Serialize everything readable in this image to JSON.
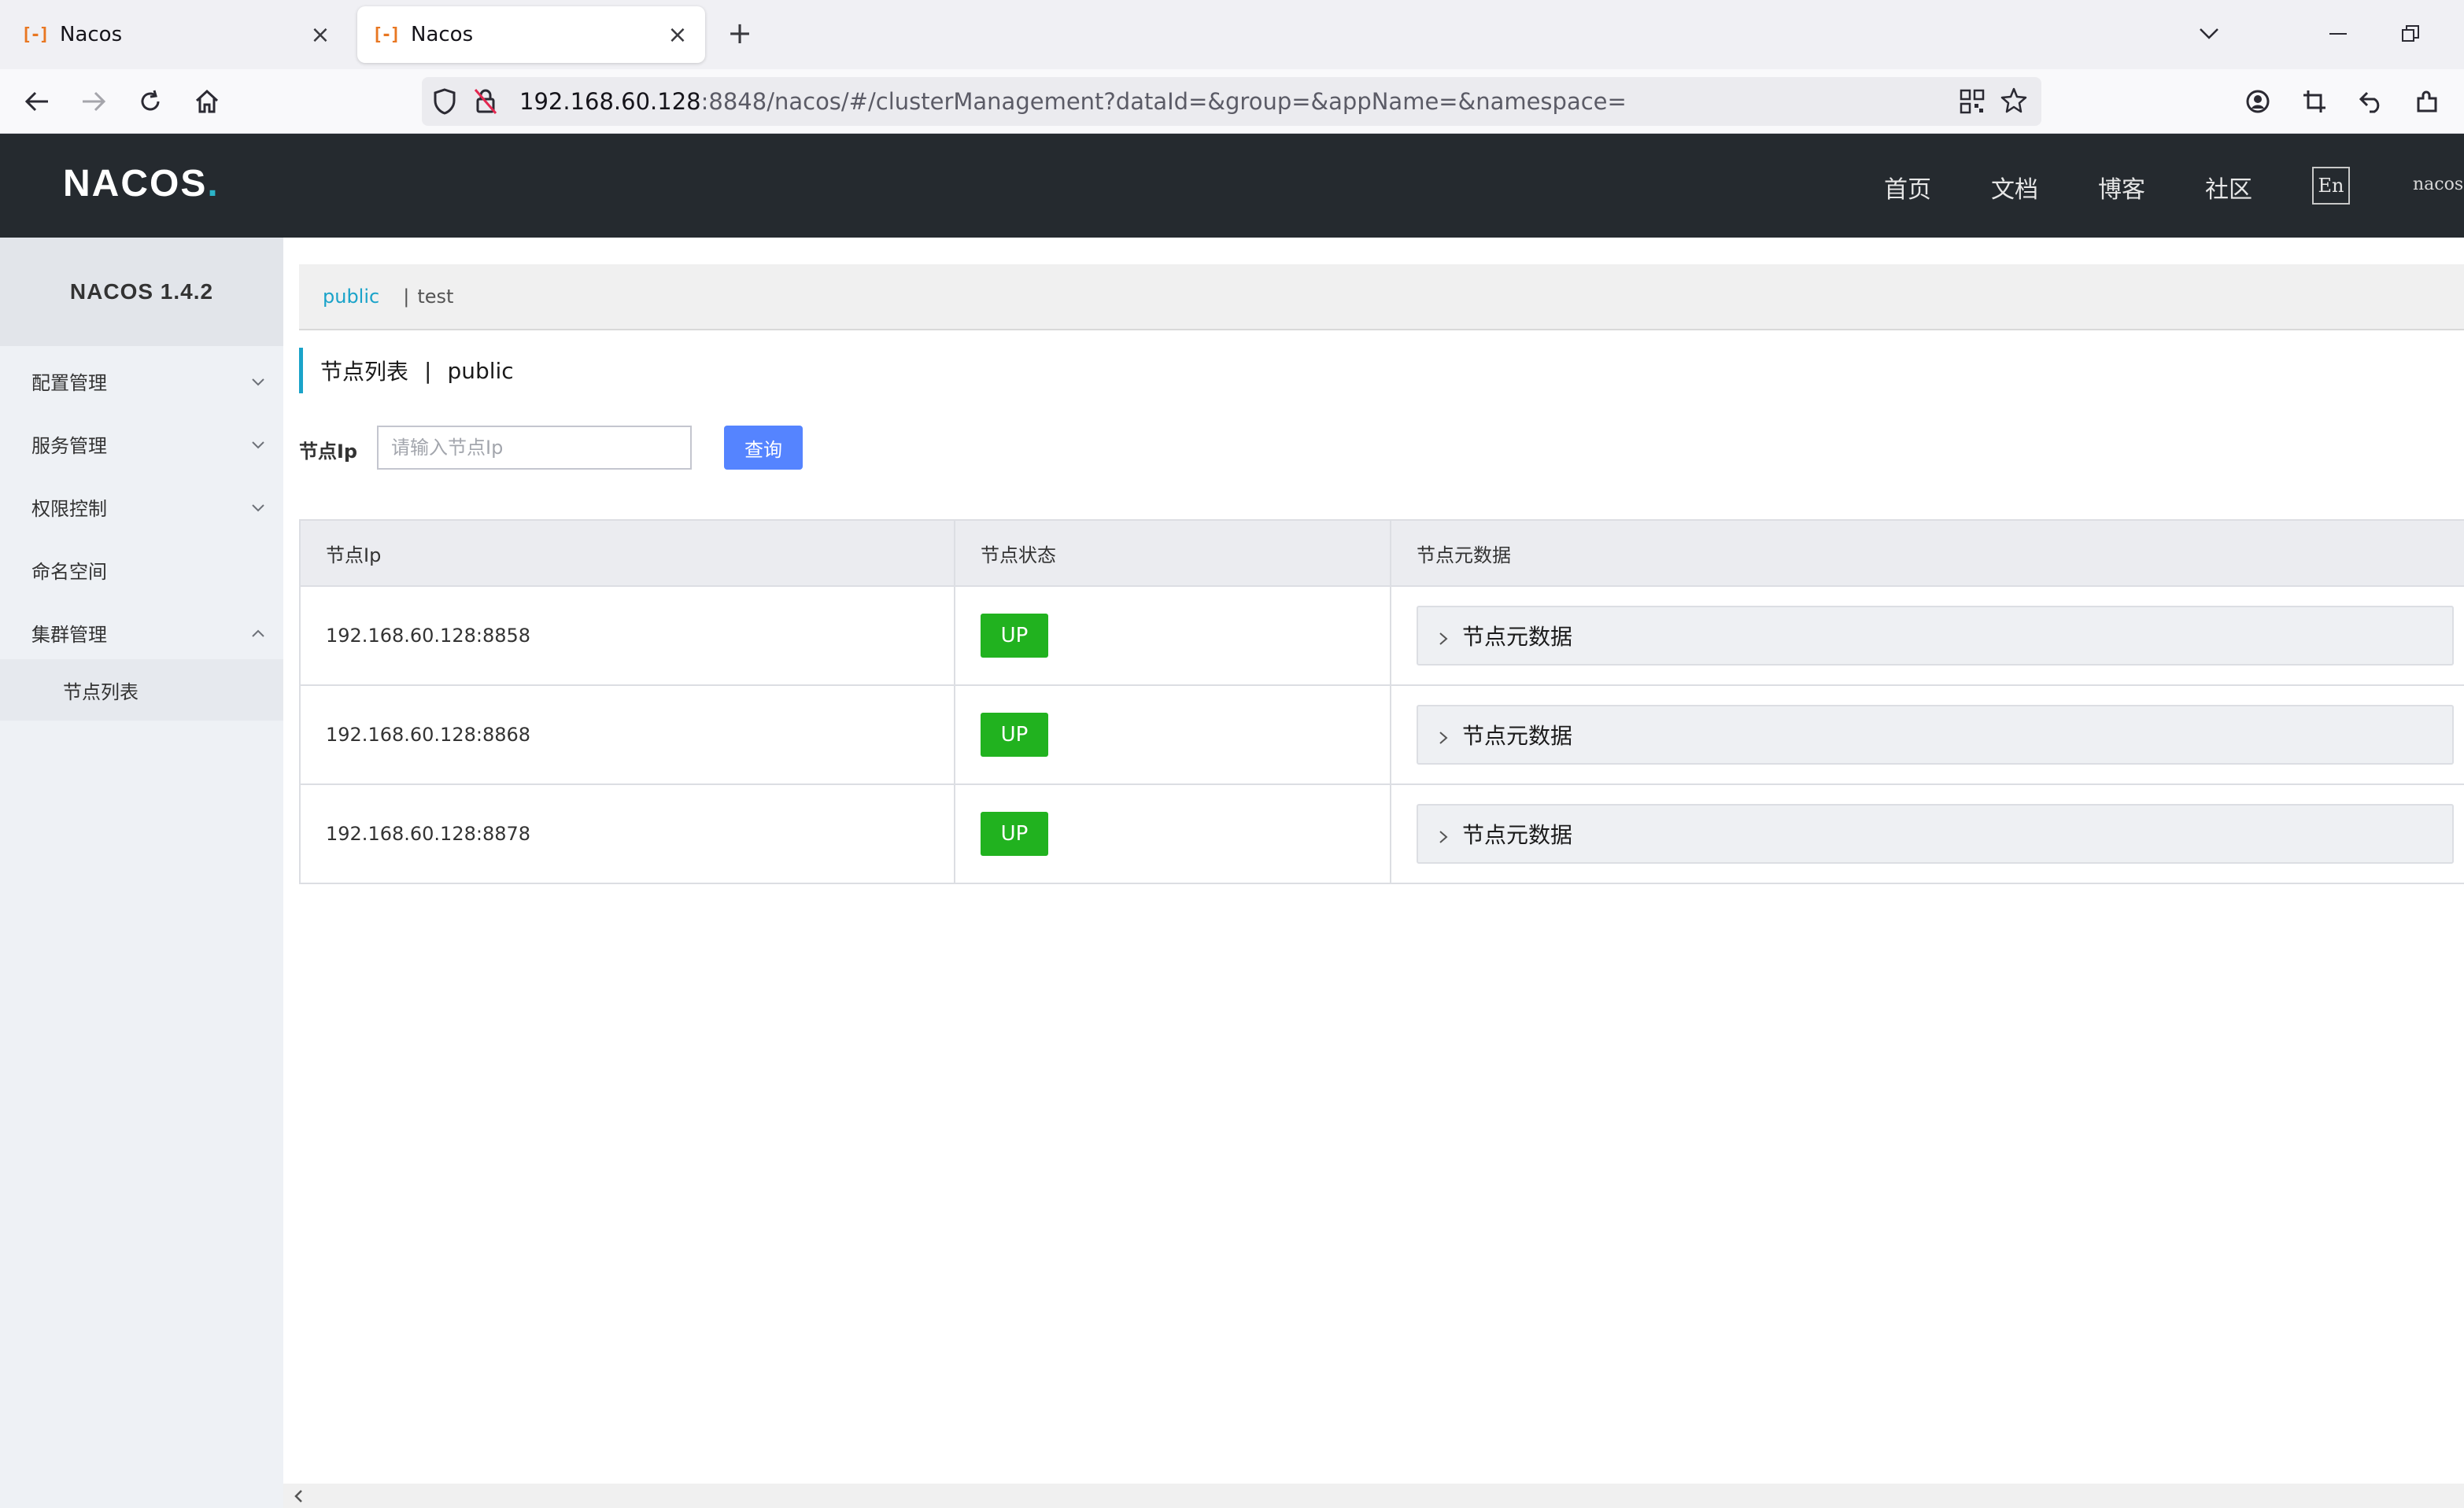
{
  "browser": {
    "tabs": [
      {
        "title": "Nacos",
        "favicon": "[-]",
        "active": false
      },
      {
        "title": "Nacos",
        "favicon": "[-]",
        "active": true
      }
    ],
    "url": {
      "host": "192.168.60.128",
      "rest": ":8848/nacos/#/clusterManagement?dataId=&group=&appName=&namespace="
    }
  },
  "header": {
    "logo": "NACOS",
    "logo_dot": ".",
    "links": [
      "首页",
      "文档",
      "博客",
      "社区"
    ],
    "lang": "En",
    "user": "nacos"
  },
  "sidebar": {
    "version": "NACOS 1.4.2",
    "items": [
      {
        "label": "配置管理",
        "expandable": true,
        "expanded": false
      },
      {
        "label": "服务管理",
        "expandable": true,
        "expanded": false
      },
      {
        "label": "权限控制",
        "expandable": true,
        "expanded": false
      },
      {
        "label": "命名空间",
        "expandable": false
      },
      {
        "label": "集群管理",
        "expandable": true,
        "expanded": true
      }
    ],
    "subitem": "节点列表"
  },
  "namespaces": {
    "active": "public",
    "separator": "|",
    "other": "test"
  },
  "page": {
    "title": "节点列表",
    "separator": "|",
    "namespace": "public"
  },
  "filter": {
    "label": "节点Ip",
    "placeholder": "请输入节点Ip",
    "value": "",
    "button": "查询"
  },
  "table": {
    "columns": [
      "节点Ip",
      "节点状态",
      "节点元数据"
    ],
    "rows": [
      {
        "ip": "192.168.60.128:8858",
        "status": "UP",
        "meta": "节点元数据"
      },
      {
        "ip": "192.168.60.128:8868",
        "status": "UP",
        "meta": "节点元数据"
      },
      {
        "ip": "192.168.60.128:8878",
        "status": "UP",
        "meta": "节点元数据"
      }
    ]
  },
  "colors": {
    "accent": "#1aa3c9",
    "primary_button": "#5584ff",
    "status_up": "#21b21f",
    "header_bg": "#252a2f"
  }
}
